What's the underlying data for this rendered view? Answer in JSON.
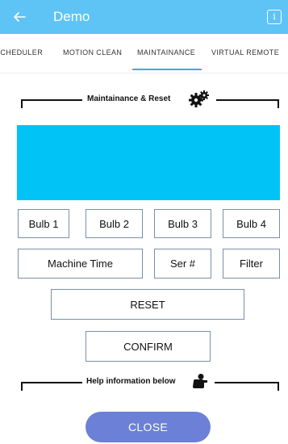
{
  "app": {
    "title": "Demo",
    "info_glyph": "i",
    "accent_color": "#5ec3f5"
  },
  "tabs": [
    {
      "label": "SCHEDULER"
    },
    {
      "label": "MOTION CLEAN"
    },
    {
      "label": "MAINTAINANCE",
      "selected": true
    },
    {
      "label": "VIRTUAL REMOTE"
    }
  ],
  "maintenance_section": {
    "label": "Maintainance & Reset",
    "icon": "gear-icon"
  },
  "display_panel": {
    "color": "#02c3f6"
  },
  "buttons": {
    "bulb1": "Bulb 1",
    "bulb2": "Bulb 2",
    "bulb3": "Bulb 3",
    "bulb4": "Bulb 4",
    "machine_time": "Machine Time",
    "serial": "Ser #",
    "filter": "Filter",
    "reset": "RESET",
    "confirm": "CONFIRM"
  },
  "help_section": {
    "label": "Help information below",
    "icon": "person-seat-icon"
  },
  "close": {
    "label": "CLOSE",
    "color": "#6b80d6"
  }
}
